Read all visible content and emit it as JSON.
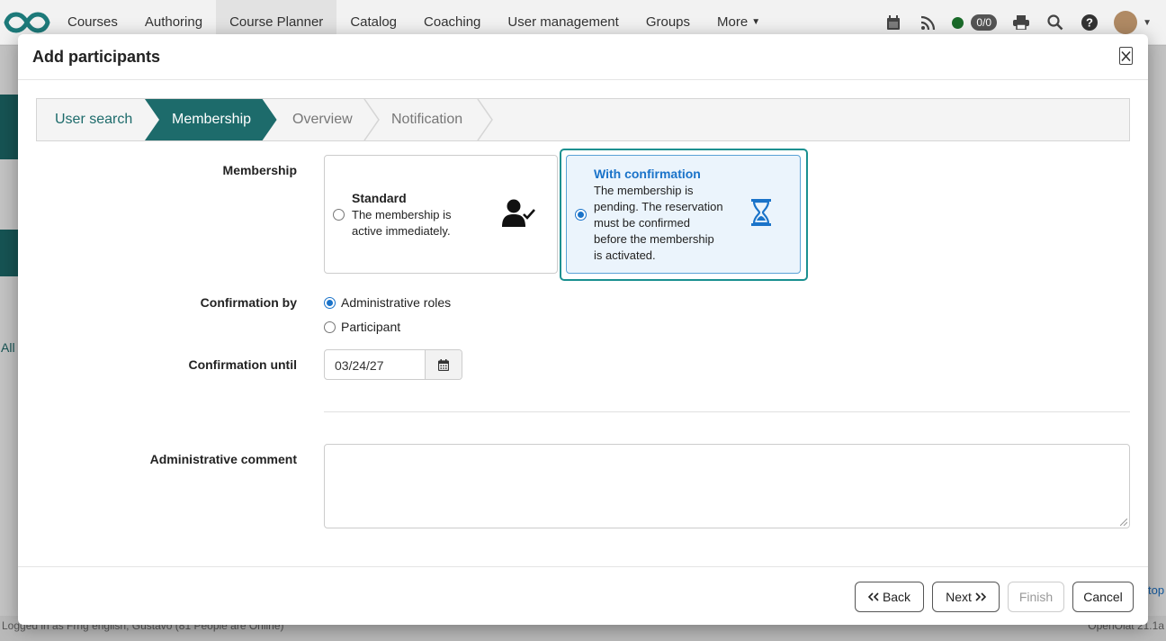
{
  "nav": {
    "items": [
      "Courses",
      "Authoring",
      "Course Planner",
      "Catalog",
      "Coaching",
      "User management",
      "Groups",
      "More"
    ],
    "active": "Course Planner",
    "badge": "0/0",
    "status_color": "#1a6b2a"
  },
  "background": {
    "tab_all": "All",
    "footer_left": "Logged in as Frhg english, Gustavo  (81 People are Online)",
    "footer_right": "OpenOlat 21.1a",
    "top_link": "top"
  },
  "modal": {
    "title": "Add participants",
    "steps": [
      "User search",
      "Membership",
      "Overview",
      "Notification"
    ],
    "active_step": "Membership",
    "membership_label": "Membership",
    "standard": {
      "title": "Standard",
      "desc_lines": [
        "The membership is",
        "active immediately."
      ],
      "icon": "user-check-icon"
    },
    "with_confirmation": {
      "title": "With confirmation",
      "desc_lines": [
        "The membership is",
        "pending. The reservation",
        "must be confirmed",
        "before the membership",
        "is activated."
      ],
      "icon": "hourglass-icon"
    },
    "confirmation_by_label": "Confirmation by",
    "confirmation_by_options": [
      "Administrative roles",
      "Participant"
    ],
    "confirmation_by_selected": "Administrative roles",
    "confirmation_until_label": "Confirmation until",
    "confirmation_until_value": "03/24/27",
    "admin_comment_label": "Administrative comment",
    "admin_comment_value": "",
    "buttons": {
      "back": "Back",
      "next": "Next",
      "finish": "Finish",
      "cancel": "Cancel"
    }
  },
  "colors": {
    "accent_teal": "#1d6b6b",
    "highlight_border": "#1a9090",
    "link_blue": "#1a73c9"
  }
}
